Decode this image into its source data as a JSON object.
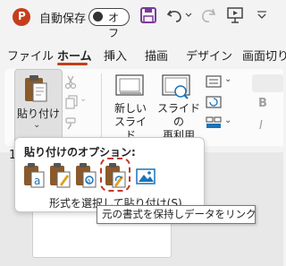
{
  "titlebar": {
    "autosave_label": "自動保存",
    "autosave_state": "オフ",
    "app_icon_letter": "P"
  },
  "tabs": [
    "ファイル",
    "ホーム",
    "挿入",
    "描画",
    "デザイン",
    "画面切り"
  ],
  "ribbon": {
    "paste_label": "貼り付け",
    "new_slide_label": "新しい\nスライド",
    "new_slide_line1": "新しい",
    "new_slide_line2": "スライド",
    "reuse_slide_line1": "スライドの",
    "reuse_slide_line2": "再利用",
    "bold_letter": "B",
    "italic_letter": "I"
  },
  "slide_pane": {
    "slide_number": "1"
  },
  "paste_options": {
    "title": "貼り付けのオプション:",
    "footer": "形式を選択して貼り付け(S)..."
  },
  "tooltip": {
    "text": "元の書式を保持しデータをリンク (F)"
  },
  "colors": {
    "accent": "#c43e1c",
    "highlight": "#c0392b",
    "save_icon": "#7a3b9c"
  }
}
